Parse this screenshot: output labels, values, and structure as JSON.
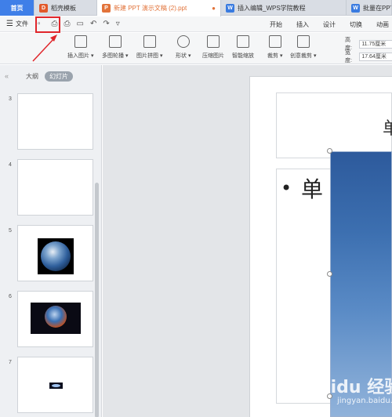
{
  "tabs": [
    {
      "label": "首页",
      "kind": "home"
    },
    {
      "label": "稻壳模板",
      "kind": "normal",
      "icon_color": "#e2592a",
      "icon": "docer-icon"
    },
    {
      "label": "新建 PPT 演示文稿 (2).ppt",
      "kind": "active",
      "icon_color": "#e2733a",
      "icon": "ppt-icon",
      "close": "●"
    },
    {
      "label": "插入编辑_WPS学院教程",
      "kind": "normal",
      "icon_color": "#3a7be0",
      "icon": "wps-icon"
    },
    {
      "label": "批量在PPT",
      "kind": "normal",
      "icon_color": "#3a7be0",
      "icon": "wps-icon"
    }
  ],
  "menubar": {
    "file_label": "文件",
    "quick_access": [
      "save",
      "undo-save",
      "print",
      "preview",
      "undo",
      "redo",
      "more"
    ],
    "ribbon_tabs": [
      "开始",
      "插入",
      "设计",
      "切换",
      "动画"
    ]
  },
  "ribbon": {
    "buttons": [
      {
        "label": "插入图片 ▾",
        "icon": "insert-image-icon"
      },
      {
        "label": "多图轮播 ▾",
        "icon": "carousel-icon"
      },
      {
        "label": "图片拼图 ▾",
        "icon": "collage-icon"
      },
      {
        "label": "形状 ▾",
        "icon": "shape-icon"
      },
      {
        "label": "压缩图片",
        "icon": "compress-icon"
      },
      {
        "label": "智能缩放",
        "icon": "smart-scale-icon"
      },
      {
        "label": "裁剪 ▾",
        "icon": "crop-icon"
      },
      {
        "label": "创意裁剪 ▾",
        "icon": "creative-crop-icon"
      }
    ],
    "height_label": "高度:",
    "height_value": "11.75厘米",
    "width_label": "宽度:",
    "width_value": "17.64厘米"
  },
  "sidebar": {
    "collapse": "«",
    "outline_label": "大纲",
    "slides_label": "幻灯片",
    "thumbnails": [
      {
        "num": "3",
        "content": "blank"
      },
      {
        "num": "4",
        "content": "blank"
      },
      {
        "num": "5",
        "content": "earth"
      },
      {
        "num": "6",
        "content": "earth-hands"
      },
      {
        "num": "7",
        "content": "galaxy"
      }
    ]
  },
  "slide": {
    "title_char": "单",
    "body_text": "单",
    "bullet": "•"
  },
  "watermark": {
    "text": "Baidu 经验",
    "sub": "jingyan.baidu.com"
  },
  "colors": {
    "tab_active_text": "#e2733a",
    "home_tab": "#3f7fe8",
    "highlight": "#e0262b"
  }
}
